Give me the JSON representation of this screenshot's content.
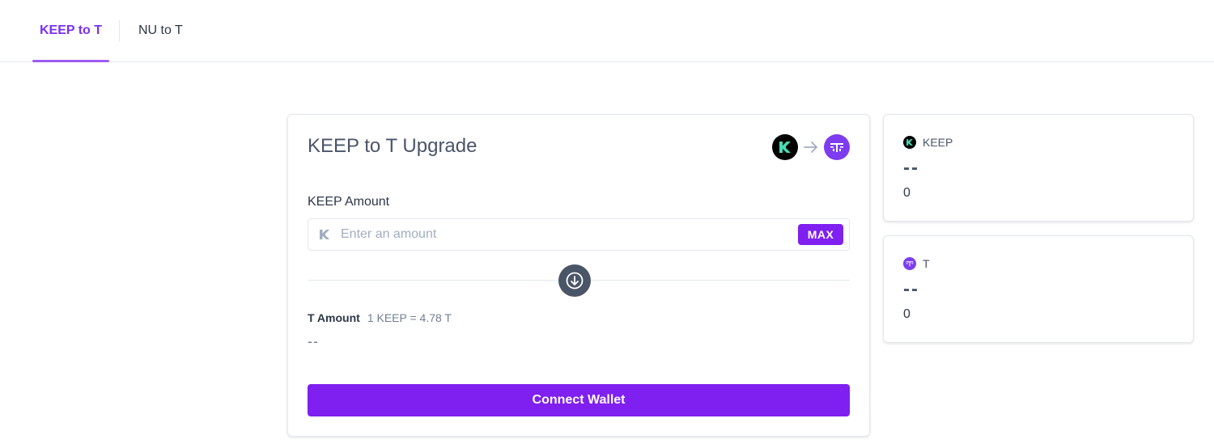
{
  "tabs": [
    {
      "label": "KEEP to T",
      "active": true
    },
    {
      "label": "NU to T",
      "active": false
    }
  ],
  "upgrade_card": {
    "title": "KEEP to T Upgrade",
    "from_token_icon": "keep-logo-icon",
    "to_token_icon": "t-logo-icon",
    "arrow_icon": "arrow-right-icon",
    "amount_label": "KEEP Amount",
    "amount_placeholder": "Enter an amount",
    "amount_value": "",
    "max_label": "MAX",
    "swap_icon": "arrow-down-circle-icon",
    "t_amount_label": "T Amount",
    "rate": "1 KEEP = 4.78 T",
    "t_amount_value": "--",
    "connect_label": "Connect Wallet"
  },
  "balances": [
    {
      "token": "KEEP",
      "icon": "keep-logo-icon",
      "amount": "--",
      "usd": "0"
    },
    {
      "token": "T",
      "icon": "t-logo-icon",
      "amount": "--",
      "usd": "0"
    }
  ],
  "colors": {
    "accent": "#7f1ff0",
    "tab_active": "#7b2ff7",
    "keep_green": "#48dbb4",
    "t_purple": "#7d3cf0"
  }
}
